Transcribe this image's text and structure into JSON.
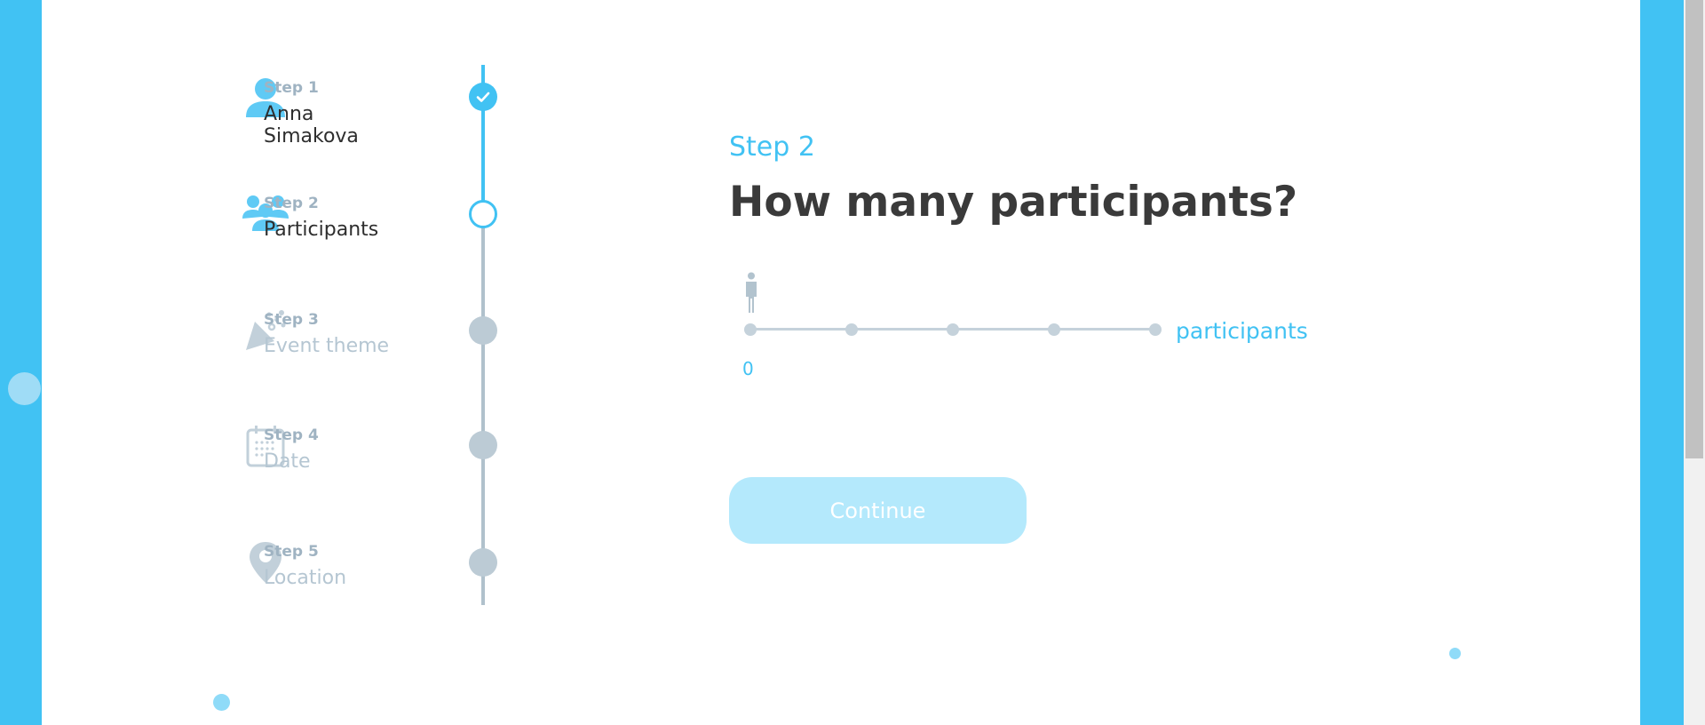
{
  "colors": {
    "accent": "#41c2f3",
    "inactive": "#b5c6d2",
    "button_bg": "#b4e9fc",
    "title": "#3a3a3a"
  },
  "steps": [
    {
      "label": "Step 1",
      "name_line1": "Anna",
      "name_line2": "Simakova",
      "icon": "user-icon",
      "status": "completed"
    },
    {
      "label": "Step 2",
      "name": "Participants",
      "icon": "users-icon",
      "status": "current"
    },
    {
      "label": "Step 3",
      "name": "Event theme",
      "icon": "party-popper-icon",
      "status": "pending"
    },
    {
      "label": "Step 4",
      "name": "Date",
      "icon": "calendar-icon",
      "status": "pending"
    },
    {
      "label": "Step 5",
      "name": "Location",
      "icon": "map-pin-icon",
      "status": "pending"
    }
  ],
  "main": {
    "step_label": "Step 2",
    "title": "How many participants?",
    "slider": {
      "value": "0",
      "unit_label": "participants",
      "tick_count": 5,
      "icon": "person-icon"
    },
    "continue_label": "Continue"
  }
}
